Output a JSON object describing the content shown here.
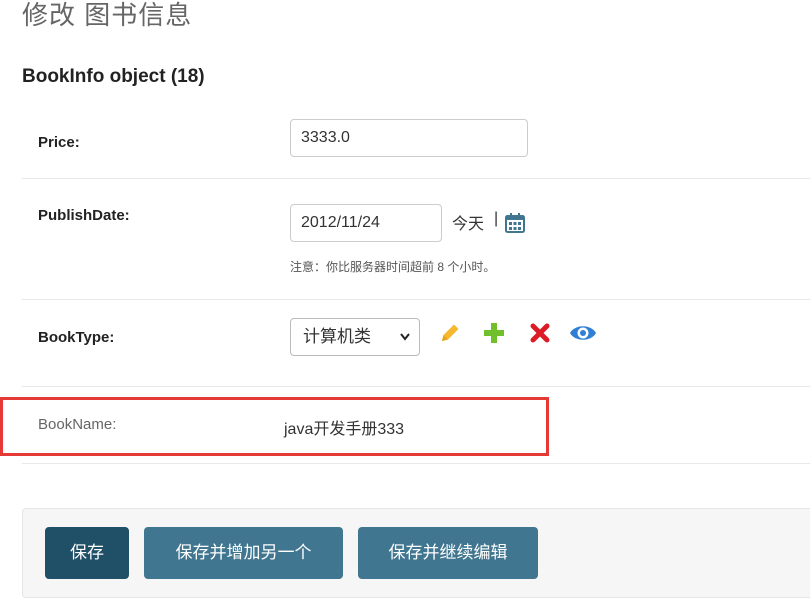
{
  "page": {
    "title": "修改 图书信息"
  },
  "fieldset": {
    "title": "BookInfo object (18)"
  },
  "fields": {
    "price": {
      "label": "Price:",
      "value": "3333.0"
    },
    "publish_date": {
      "label": "PublishDate:",
      "value": "2012/11/24",
      "today_link": "今天",
      "separator": "|",
      "help": "注意：你比服务器时间超前 8 个小时。"
    },
    "book_type": {
      "label": "BookType:",
      "selected": "计算机类"
    },
    "book_name": {
      "label": "BookName:",
      "value": "java开发手册333"
    }
  },
  "related_widget_icons": [
    "pencil-icon",
    "plus-icon",
    "x-icon",
    "eye-icon"
  ],
  "calendar_icon": "calendar-icon",
  "buttons": {
    "save": "保存",
    "save_add_another": "保存并增加另一个",
    "save_continue": "保存并继续编辑"
  },
  "colors": {
    "primary_button": "#205067",
    "secondary_button": "#417690",
    "highlight": "#e53935",
    "pencil": "#f5b82e",
    "plus": "#70bf2b",
    "delete": "#dd1b27",
    "view": "#2f7fd6"
  }
}
